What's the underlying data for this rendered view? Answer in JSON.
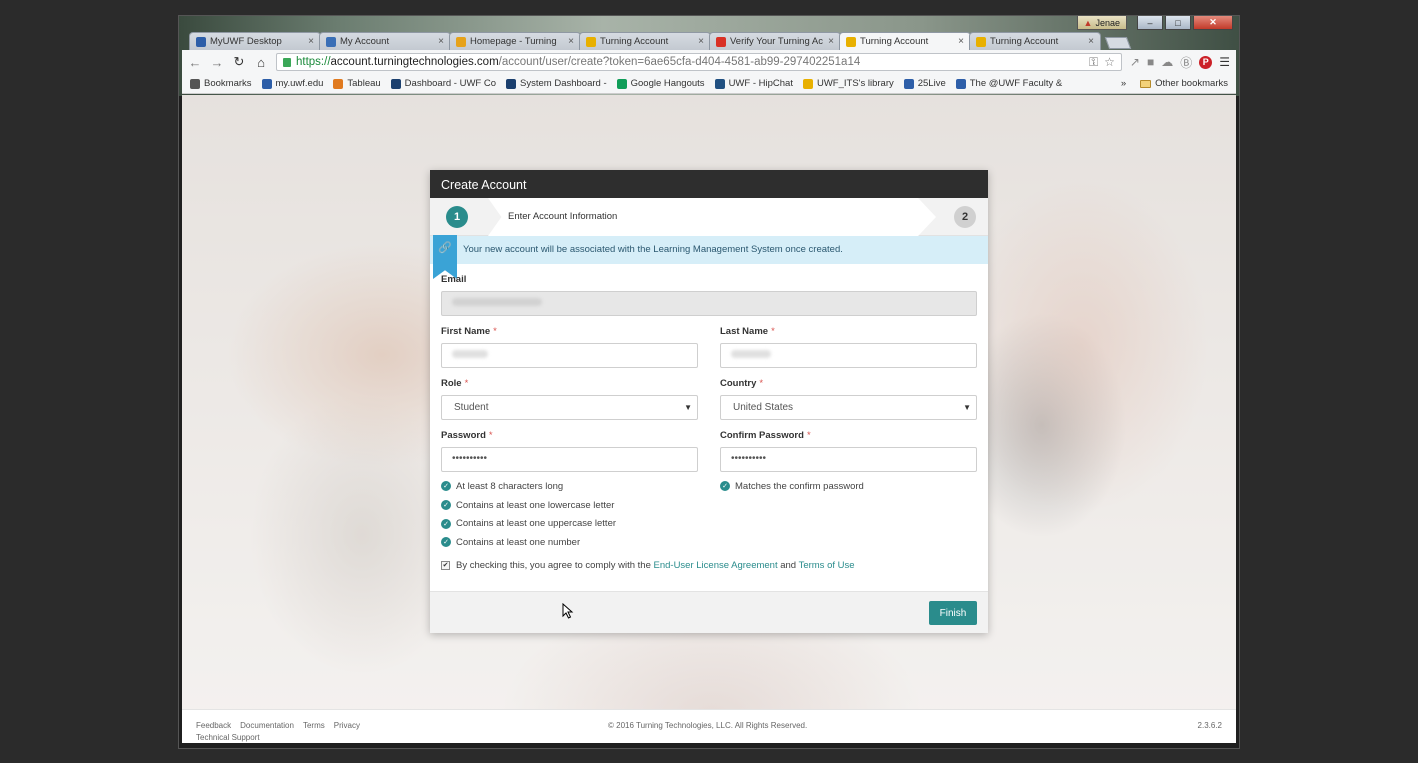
{
  "window": {
    "user": "Jenae",
    "minimize": "–",
    "maximize": "□",
    "close": "✕"
  },
  "tabs": [
    {
      "label": "MyUWF Desktop",
      "color": "#2d5ea8"
    },
    {
      "label": "My Account",
      "color": "#3a6fb6"
    },
    {
      "label": "Homepage - Turning",
      "color": "#e6a21a"
    },
    {
      "label": "Turning Account",
      "color": "#e8b000"
    },
    {
      "label": "Verify Your Turning Ac",
      "color": "#d93025"
    },
    {
      "label": "Turning Account",
      "color": "#e8b000",
      "active": true
    },
    {
      "label": "Turning Account",
      "color": "#e8b000"
    }
  ],
  "toolbar": {
    "url_https": "https://",
    "url_host": "account.turningtechnologies.com",
    "url_path": "/account/user/create?token=6ae65cfa-d404-4581-ab99-297402251a14"
  },
  "bookmarks": {
    "items": [
      {
        "label": "Bookmarks",
        "color": "#555"
      },
      {
        "label": "my.uwf.edu",
        "color": "#2d5ea8"
      },
      {
        "label": "Tableau",
        "color": "#e07a1f"
      },
      {
        "label": "Dashboard - UWF Co",
        "color": "#1b3f6e"
      },
      {
        "label": "System Dashboard -",
        "color": "#1b3f6e"
      },
      {
        "label": "Google Hangouts",
        "color": "#0f9d58"
      },
      {
        "label": "UWF - HipChat",
        "color": "#205081"
      },
      {
        "label": "UWF_ITS's library",
        "color": "#e8b000"
      },
      {
        "label": "25Live",
        "color": "#2d5ea8"
      },
      {
        "label": "The @UWF Faculty &",
        "color": "#2d5ea8"
      }
    ],
    "more": "»",
    "other": "Other bookmarks"
  },
  "card": {
    "title": "Create Account",
    "step1_num": "1",
    "step1_label": "Enter Account Information",
    "step2_num": "2",
    "info": "Your new account will be associated with the Learning Management System once created.",
    "email_label": "Email",
    "first_name_label": "First Name",
    "last_name_label": "Last Name",
    "role_label": "Role",
    "role_value": "Student",
    "country_label": "Country",
    "country_value": "United States",
    "password_label": "Password",
    "password_value": "••••••••••",
    "confirm_label": "Confirm Password",
    "confirm_value": "••••••••••",
    "required": "*",
    "rules": [
      "At least 8 characters long",
      "Contains at least one lowercase letter",
      "Contains at least one uppercase letter",
      "Contains at least one number"
    ],
    "confirm_rule": "Matches the confirm password",
    "agree_prefix": "By checking this, you agree to comply with the",
    "eula": "End-User License Agreement",
    "and": "and",
    "terms": "Terms of Use",
    "finish": "Finish"
  },
  "footer": {
    "feedback": "Feedback",
    "documentation": "Documentation",
    "terms": "Terms",
    "privacy": "Privacy",
    "support": "Technical Support",
    "copyright": "© 2016 Turning Technologies, LLC. All Rights Reserved.",
    "version": "2.3.6.2"
  },
  "colors": {
    "accent": "#2a8c8c",
    "info_bg": "#d6eef8",
    "required": "#d9534f"
  }
}
